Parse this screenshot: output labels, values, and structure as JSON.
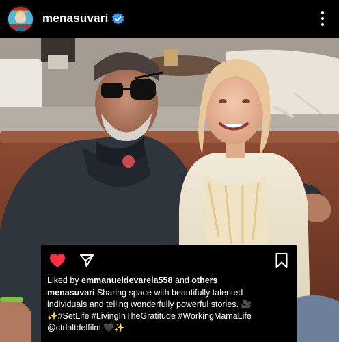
{
  "post": {
    "username": "menasuvari",
    "verified": true,
    "liked": true
  },
  "icons": {
    "avatar": "profile-avatar",
    "verified": "verified-badge-icon",
    "more": "more-options-icon",
    "like": "heart-icon",
    "share": "send-icon",
    "save": "bookmark-icon"
  },
  "colors": {
    "like": "#ff3040",
    "verified": "#3897f0"
  },
  "likes": {
    "prefix": "Liked by",
    "user": "emmanueldevarela558",
    "connector": "and",
    "others": "others"
  },
  "caption": {
    "author": "menasuvari",
    "line1": " Sharing space with beautifully talented",
    "line2": "individuals and telling wonderfully powerful stories. 🎥",
    "line3": "✨#SetLife #LivingInTheGratitude #WorkingMamaLife",
    "line4": "@ctrlaltdelfilm 🖤✨"
  }
}
